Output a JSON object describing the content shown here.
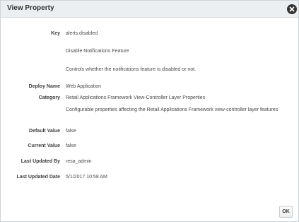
{
  "dialog": {
    "title": "View Property",
    "close_icon": "close-circle-icon",
    "ok_label": "OK"
  },
  "properties": {
    "key": {
      "label": "Key",
      "value": "alerts.disabled"
    },
    "key_name": "Disable Notifications Feature",
    "key_description": "Controls whether the notifications feature is disabled or not.",
    "deploy_name": {
      "label": "Deploy Name",
      "value": "Web Application"
    },
    "category": {
      "label": "Category",
      "value": "Retail Applications Framework View-Controller Layer Properties"
    },
    "category_description": "Configurable properties affecting the Retail Applications Framework view-controller layer features",
    "default_value": {
      "label": "Default Value",
      "value": "false"
    },
    "current_value": {
      "label": "Current Value",
      "value": "false"
    },
    "last_updated_by": {
      "label": "Last Updated By",
      "value": "resa_admin"
    },
    "last_updated_date": {
      "label": "Last Updated Date",
      "value": "5/1/2017 10:58 AM"
    }
  }
}
